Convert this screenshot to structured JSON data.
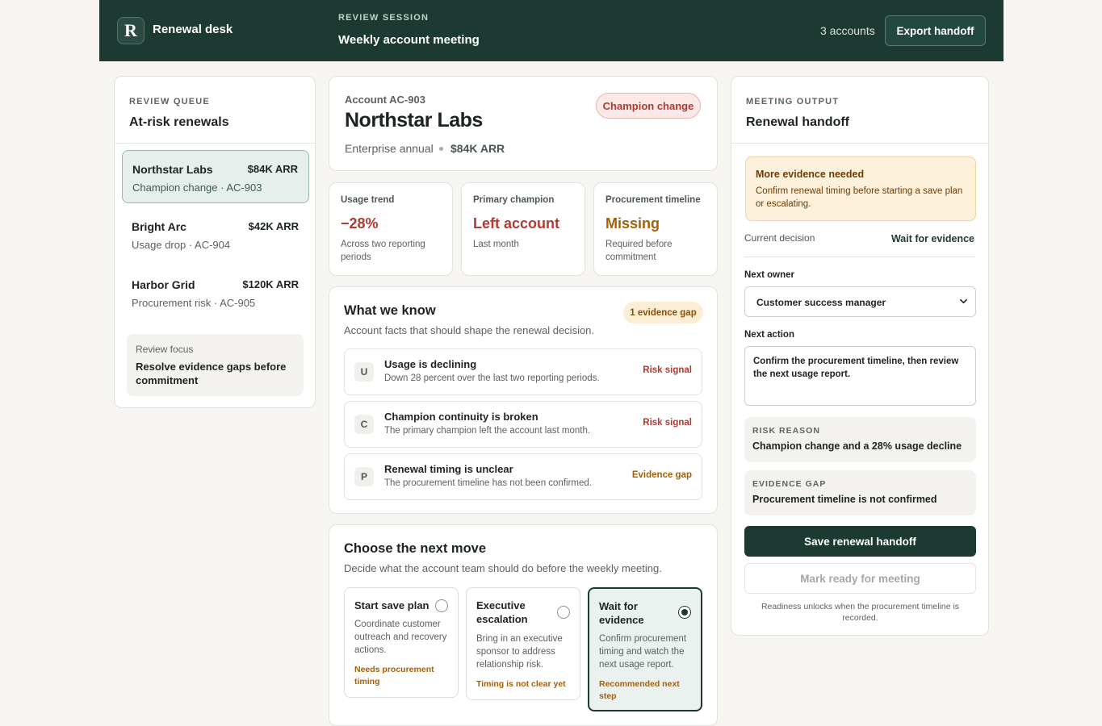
{
  "header": {
    "logo_letter": "R",
    "app_name": "Renewal desk",
    "session_eyebrow": "REVIEW SESSION",
    "session_title": "Weekly account meeting",
    "account_count": "3 accounts",
    "export_label": "Export handoff"
  },
  "queue": {
    "eyebrow": "REVIEW QUEUE",
    "title": "At-risk renewals",
    "items": [
      {
        "name": "Northstar Labs",
        "arr": "$84K ARR",
        "sub": "Champion change · AC-903",
        "active": true
      },
      {
        "name": "Bright Arc",
        "arr": "$42K ARR",
        "sub": "Usage drop · AC-904",
        "active": false
      },
      {
        "name": "Harbor Grid",
        "arr": "$120K ARR",
        "sub": "Procurement risk · AC-905",
        "active": false
      }
    ],
    "focus_label": "Review focus",
    "focus_text": "Resolve evidence gaps before commitment"
  },
  "account": {
    "id": "Account AC-903",
    "name": "Northstar Labs",
    "plan": "Enterprise annual",
    "arr": "$84K ARR",
    "badge": "Champion change"
  },
  "metrics": [
    {
      "label": "Usage trend",
      "value": "−28%",
      "sub": "Across two reporting periods",
      "tone": "red"
    },
    {
      "label": "Primary champion",
      "value": "Left account",
      "sub": "Last month",
      "tone": "red"
    },
    {
      "label": "Procurement timeline",
      "value": "Missing",
      "sub": "Required before commitment",
      "tone": "amber"
    }
  ],
  "know": {
    "title": "What we know",
    "subtitle": "Account facts that should shape the renewal decision.",
    "gap_badge": "1 evidence gap",
    "facts": [
      {
        "letter": "U",
        "title": "Usage is declining",
        "sub": "Down 28 percent over the last two reporting periods.",
        "tag": "Risk signal",
        "tone": "red"
      },
      {
        "letter": "C",
        "title": "Champion continuity is broken",
        "sub": "The primary champion left the account last month.",
        "tag": "Risk signal",
        "tone": "red"
      },
      {
        "letter": "P",
        "title": "Renewal timing is unclear",
        "sub": "The procurement timeline has not been confirmed.",
        "tag": "Evidence gap",
        "tone": "amber"
      }
    ]
  },
  "moves": {
    "title": "Choose the next move",
    "subtitle": "Decide what the account team should do before the weekly meeting.",
    "options": [
      {
        "title": "Start save plan",
        "desc": "Coordinate customer outreach and recovery actions.",
        "note": "Needs procurement timing",
        "selected": false
      },
      {
        "title": "Executive escalation",
        "desc": "Bring in an executive sponsor to address relationship risk.",
        "note": "Timing is not clear yet",
        "selected": false
      },
      {
        "title": "Wait for evidence",
        "desc": "Confirm procurement timing and watch the next usage report.",
        "note": "Recommended next step",
        "selected": true
      }
    ]
  },
  "output": {
    "eyebrow": "MEETING OUTPUT",
    "title": "Renewal handoff",
    "alert_title": "More evidence needed",
    "alert_text": "Confirm renewal timing before starting a save plan or escalating.",
    "decision_label": "Current decision",
    "decision_value": "Wait for evidence",
    "owner_label": "Next owner",
    "owner_value": "Customer success manager",
    "action_label": "Next action",
    "action_value": "Confirm the procurement timeline, then review the next usage report.",
    "risk_label": "RISK REASON",
    "risk_value": "Champion change and a 28% usage decline",
    "gap_label": "EVIDENCE GAP",
    "gap_value": "Procurement timeline is not confirmed",
    "save_label": "Save renewal handoff",
    "ready_label": "Mark ready for meeting",
    "ready_note": "Readiness unlocks when the procurement timeline is recorded."
  },
  "colors": {
    "brand": "#1c3a32",
    "risk": "#b23a32",
    "warning": "#a45f0a"
  }
}
